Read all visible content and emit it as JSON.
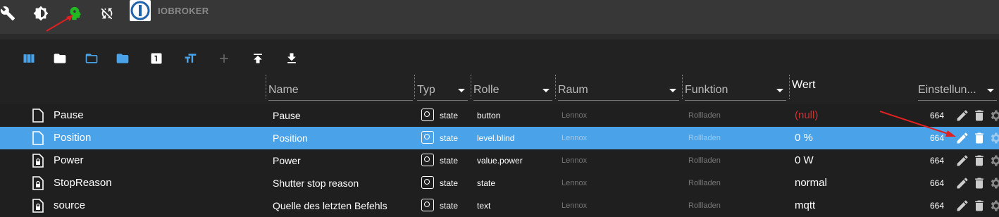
{
  "topbar": {
    "brand": "IOBROKER",
    "icons": [
      "wrench-icon",
      "brightness-icon",
      "expert-mode-icon",
      "sync-disabled-icon"
    ]
  },
  "toolbar": {
    "icons": [
      "columns-icon",
      "folder-icon",
      "folder-open-icon",
      "folder-blue-icon",
      "one-icon",
      "text-size-icon",
      "plus-icon",
      "upload-icon",
      "download-icon"
    ]
  },
  "columns": {
    "name": "Name",
    "type": "Typ",
    "role": "Rolle",
    "room": "Raum",
    "function": "Funktion",
    "value": "Wert",
    "settings": "Einstellun..."
  },
  "rows": [
    {
      "id": "Pause",
      "name": "Pause",
      "type": "state",
      "role": "button",
      "room": "Lennox",
      "function": "Rollladen",
      "value": "(null)",
      "num": "664"
    },
    {
      "id": "Position",
      "name": "Position",
      "type": "state",
      "role": "level.blind",
      "room": "Lennox",
      "function": "Rollladen",
      "value": "0 %",
      "num": "664"
    },
    {
      "id": "Power",
      "name": "Power",
      "type": "state",
      "role": "value.power",
      "room": "Lennox",
      "function": "Rollladen",
      "value": "0 W",
      "num": "664"
    },
    {
      "id": "StopReason",
      "name": "Shutter stop reason",
      "type": "state",
      "role": "state",
      "room": "Lennox",
      "function": "Rollladen",
      "value": "normal",
      "num": "664"
    },
    {
      "id": "source",
      "name": "Quelle des letzten Befehls",
      "type": "state",
      "role": "text",
      "room": "Lennox",
      "function": "Rollladen",
      "value": "mqtt",
      "num": "664"
    }
  ],
  "colors": {
    "selected": "#4aa3e8",
    "null_value": "#d32f2f",
    "expert_icon": "#22b822",
    "annotation_arrow": "#e02020"
  }
}
